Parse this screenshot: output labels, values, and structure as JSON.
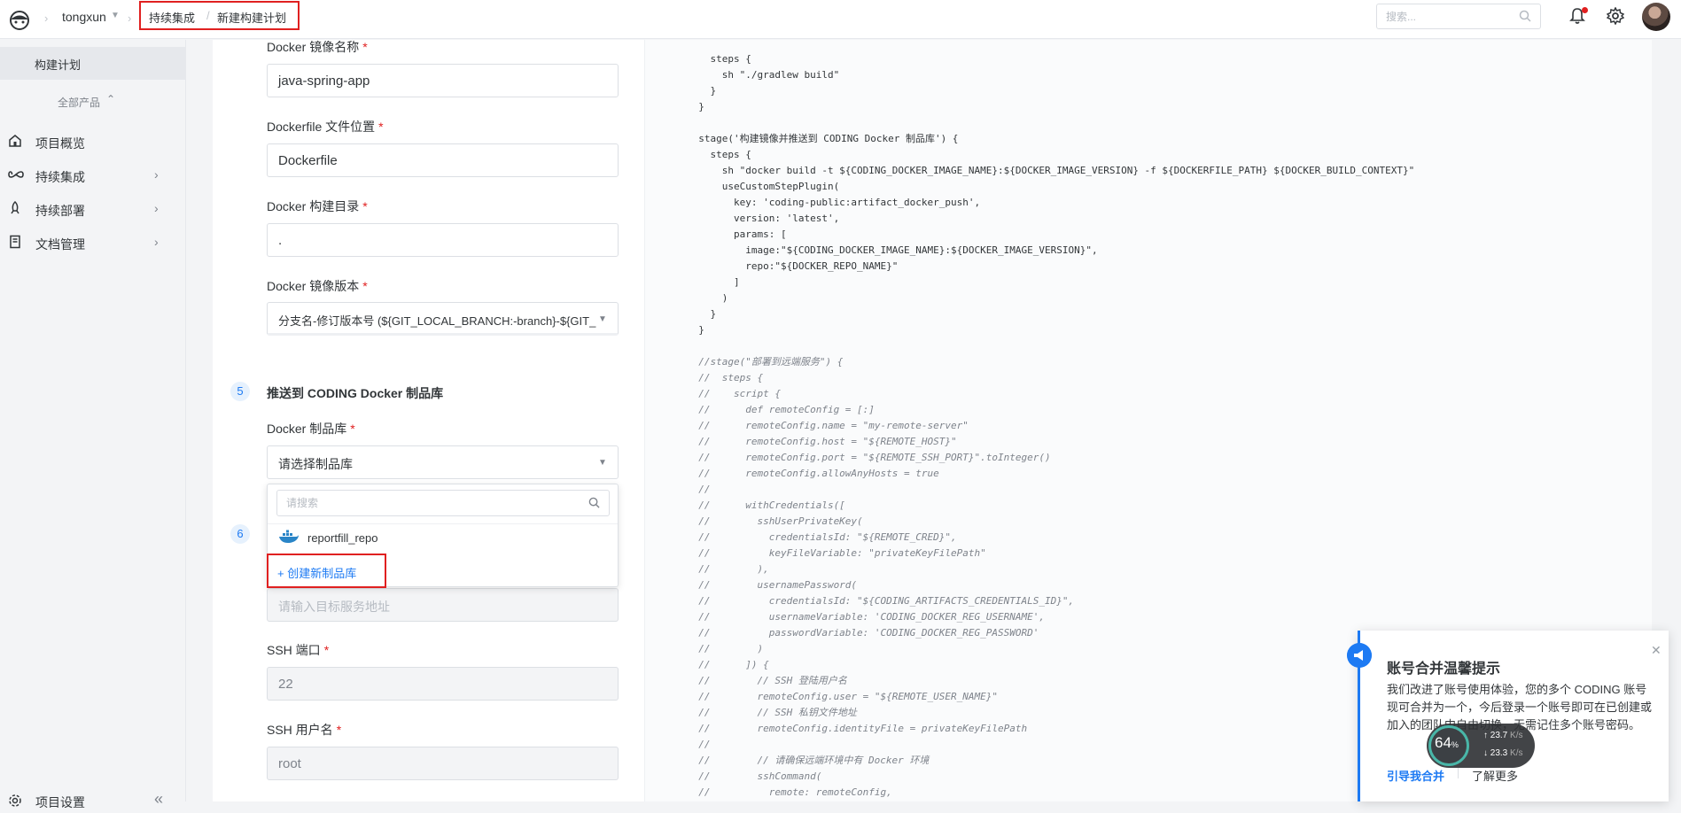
{
  "header": {
    "team": "tongxun",
    "breadcrumb": [
      "持续集成",
      "新建构建计划"
    ],
    "search_placeholder": "搜索..."
  },
  "sidebar": {
    "active": "构建计划",
    "all_products": "全部产品",
    "items": [
      {
        "label": "项目概览",
        "icon": "home-icon"
      },
      {
        "label": "持续集成",
        "icon": "infinity-icon"
      },
      {
        "label": "持续部署",
        "icon": "rocket-icon"
      },
      {
        "label": "文档管理",
        "icon": "document-icon"
      }
    ],
    "settings": "项目设置"
  },
  "form": {
    "image_name": {
      "label": "Docker 镜像名称",
      "value": "java-spring-app"
    },
    "dockerfile": {
      "label": "Dockerfile 文件位置",
      "value": "Dockerfile"
    },
    "build_dir": {
      "label": "Docker 构建目录",
      "value": "."
    },
    "image_version": {
      "label": "Docker 镜像版本",
      "value": "分支名-修订版本号 (${GIT_LOCAL_BRANCH:-branch}-${GIT_"
    },
    "step5": {
      "num": "5",
      "title": "推送到 CODING Docker 制品库"
    },
    "repo": {
      "label": "Docker 制品库",
      "placeholder": "请选择制品库"
    },
    "step6": {
      "num": "6"
    },
    "target_placeholder": "请输入目标服务地址",
    "ssh_port": {
      "label": "SSH 端口",
      "value": "22"
    },
    "ssh_user": {
      "label": "SSH 用户名",
      "value": "root"
    },
    "required_mark": "*"
  },
  "dropdown": {
    "search_placeholder": "请搜索",
    "option": "reportfill_repo",
    "create": "+ 创建新制品库"
  },
  "code_lines": [
    {
      "t": "    steps {",
      "c": ""
    },
    {
      "t": "      sh \"./gradlew build\"",
      "c": ""
    },
    {
      "t": "    }",
      "c": ""
    },
    {
      "t": "  }",
      "c": ""
    },
    {
      "t": "",
      "c": ""
    },
    {
      "t": "  stage('构建镜像并推送到 CODING Docker 制品库') {",
      "c": ""
    },
    {
      "t": "    steps {",
      "c": ""
    },
    {
      "t": "      sh \"docker build -t ${CODING_DOCKER_IMAGE_NAME}:${DOCKER_IMAGE_VERSION} -f ${DOCKERFILE_PATH} ${DOCKER_BUILD_CONTEXT}\"",
      "c": ""
    },
    {
      "t": "      useCustomStepPlugin(",
      "c": ""
    },
    {
      "t": "        key: 'coding-public:artifact_docker_push',",
      "c": ""
    },
    {
      "t": "        version: 'latest',",
      "c": ""
    },
    {
      "t": "        params: [",
      "c": ""
    },
    {
      "t": "          image:\"${CODING_DOCKER_IMAGE_NAME}:${DOCKER_IMAGE_VERSION}\",",
      "c": ""
    },
    {
      "t": "          repo:\"${DOCKER_REPO_NAME}\"",
      "c": ""
    },
    {
      "t": "        ]",
      "c": ""
    },
    {
      "t": "      )",
      "c": ""
    },
    {
      "t": "    }",
      "c": ""
    },
    {
      "t": "  }",
      "c": ""
    },
    {
      "t": "",
      "c": ""
    },
    {
      "t": "  //stage(\"部署到远端服务\") {",
      "c": "cm"
    },
    {
      "t": "  //  steps {",
      "c": "cm"
    },
    {
      "t": "  //    script {",
      "c": "cm"
    },
    {
      "t": "  //      def remoteConfig = [:]",
      "c": "cm"
    },
    {
      "t": "  //      remoteConfig.name = \"my-remote-server\"",
      "c": "cm"
    },
    {
      "t": "  //      remoteConfig.host = \"${REMOTE_HOST}\"",
      "c": "cm"
    },
    {
      "t": "  //      remoteConfig.port = \"${REMOTE_SSH_PORT}\".toInteger()",
      "c": "cm"
    },
    {
      "t": "  //      remoteConfig.allowAnyHosts = true",
      "c": "cm"
    },
    {
      "t": "  //",
      "c": "cm"
    },
    {
      "t": "  //      withCredentials([",
      "c": "cm"
    },
    {
      "t": "  //        sshUserPrivateKey(",
      "c": "cm"
    },
    {
      "t": "  //          credentialsId: \"${REMOTE_CRED}\",",
      "c": "cm"
    },
    {
      "t": "  //          keyFileVariable: \"privateKeyFilePath\"",
      "c": "cm"
    },
    {
      "t": "  //        ),",
      "c": "cm"
    },
    {
      "t": "  //        usernamePassword(",
      "c": "cm"
    },
    {
      "t": "  //          credentialsId: \"${CODING_ARTIFACTS_CREDENTIALS_ID}\",",
      "c": "cm"
    },
    {
      "t": "  //          usernameVariable: 'CODING_DOCKER_REG_USERNAME',",
      "c": "cm"
    },
    {
      "t": "  //          passwordVariable: 'CODING_DOCKER_REG_PASSWORD'",
      "c": "cm"
    },
    {
      "t": "  //        )",
      "c": "cm"
    },
    {
      "t": "  //      ]) {",
      "c": "cm"
    },
    {
      "t": "  //        // SSH 登陆用户名",
      "c": "cm"
    },
    {
      "t": "  //        remoteConfig.user = \"${REMOTE_USER_NAME}\"",
      "c": "cm"
    },
    {
      "t": "  //        // SSH 私钥文件地址",
      "c": "cm"
    },
    {
      "t": "  //        remoteConfig.identityFile = privateKeyFilePath",
      "c": "cm"
    },
    {
      "t": "  //",
      "c": "cm"
    },
    {
      "t": "  //        // 请确保远端环境中有 Docker 环境",
      "c": "cm"
    },
    {
      "t": "  //        sshCommand(",
      "c": "cm"
    },
    {
      "t": "  //          remote: remoteConfig,",
      "c": "cm"
    }
  ],
  "notice": {
    "title": "账号合并温馨提示",
    "body": "我们改进了账号使用体验，您的多个 CODING 账号现可合并为一个，今后登录一个账号即可在已创建或加入的团队中自由切换，无需记住多个账号密码。",
    "link_primary": "引导我合并",
    "link_secondary": "了解更多"
  },
  "speed_widget": {
    "percent": "64",
    "percent_unit": "%",
    "upload": "23.7",
    "download": "23.3",
    "unit": "K/s"
  },
  "colors": {
    "accent": "#1d7af3",
    "highlight": "#e02020",
    "required": "#e02020"
  }
}
